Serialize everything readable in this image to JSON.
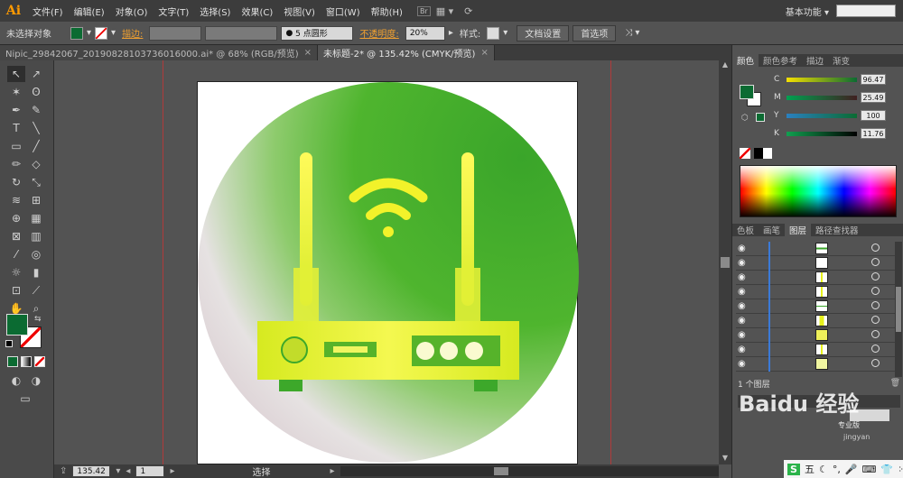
{
  "app": {
    "logo": "Ai",
    "workspace": "基本功能"
  },
  "menu": {
    "items": [
      "文件(F)",
      "编辑(E)",
      "对象(O)",
      "文字(T)",
      "选择(S)",
      "效果(C)",
      "视图(V)",
      "窗口(W)",
      "帮助(H)"
    ],
    "br_icon": "Br"
  },
  "control": {
    "selection": "未选择对象",
    "stroke_label": "描边:",
    "brush": "5 点圆形",
    "opacity_label": "不透明度:",
    "opacity": "20%",
    "style_label": "样式:",
    "doc_setup": "文档设置",
    "prefs": "首选项"
  },
  "tabs": [
    {
      "label": "Nipic_29842067_20190828103736016000.ai* @ 68% (RGB/预览)"
    },
    {
      "label": "未标题-2* @ 135.42% (CMYK/预览)"
    }
  ],
  "status": {
    "zoom": "135.42",
    "page": "1",
    "mode": "选择"
  },
  "color_panel": {
    "tabs": [
      "颜色",
      "颜色参考",
      "描边",
      "渐变"
    ],
    "channels": [
      {
        "name": "C",
        "value": "96.47"
      },
      {
        "name": "M",
        "value": "25.49"
      },
      {
        "name": "Y",
        "value": "100"
      },
      {
        "name": "K",
        "value": "11.76"
      }
    ]
  },
  "layers_panel": {
    "tabs": [
      "色板",
      "画笔",
      "图层",
      "路径查找器"
    ],
    "footer": "1 个图层"
  },
  "watermark": {
    "text": "Baidu 经验",
    "sub": "专业版",
    "sub2": "jingyan"
  },
  "ime": {
    "label": "五"
  },
  "colors": {
    "fill": "#0b6b32",
    "green_top": "#3aa52a",
    "yellow": "#e6f01c"
  }
}
